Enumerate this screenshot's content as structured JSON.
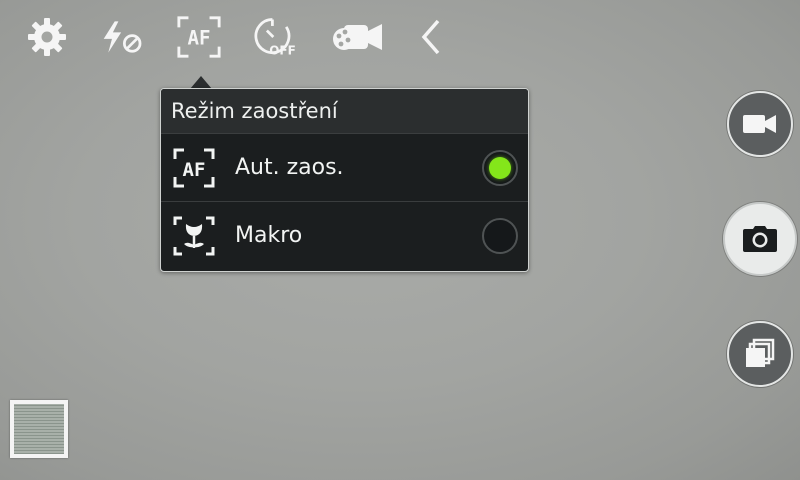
{
  "toolbar": {
    "items": [
      {
        "name": "settings",
        "icon": "gear-icon"
      },
      {
        "name": "flash",
        "icon": "flash-off-icon"
      },
      {
        "name": "focus-mode",
        "icon": "af-icon",
        "text": "AF"
      },
      {
        "name": "timer",
        "icon": "timer-off-icon",
        "text": "OFF"
      },
      {
        "name": "mode",
        "icon": "camcorder-mode-icon"
      },
      {
        "name": "collapse",
        "icon": "chevron-left-icon"
      }
    ]
  },
  "focus_popup": {
    "title": "Režim zaostření",
    "options": [
      {
        "icon": "af-icon",
        "icon_text": "AF",
        "label": "Aut. zaos.",
        "selected": true
      },
      {
        "icon": "macro-flower-icon",
        "label": "Makro",
        "selected": false
      }
    ]
  },
  "side_buttons": [
    {
      "name": "record-video",
      "icon": "video-camera-icon"
    },
    {
      "name": "shutter",
      "icon": "camera-icon"
    },
    {
      "name": "switch-camera",
      "icon": "switch-camera-icon"
    }
  ],
  "gallery": {
    "icon": "gallery-thumbnail"
  },
  "colors": {
    "accent": "#84e61a",
    "popup_bg": "#1b1e1f",
    "title_bg": "#2b2e2f"
  }
}
